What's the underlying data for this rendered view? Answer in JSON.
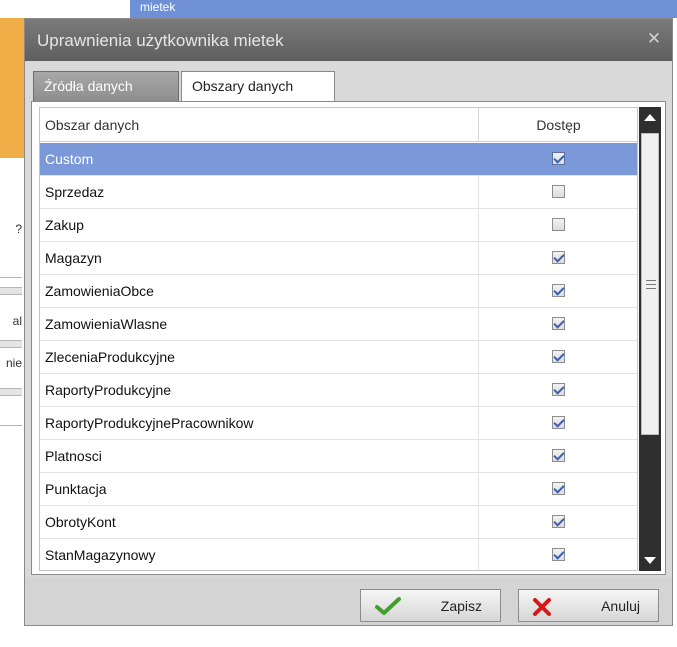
{
  "background": {
    "header_label": "mietek",
    "frag_question": "?",
    "frag_al": "al",
    "frag_nie": "nie"
  },
  "dialog": {
    "title": "Uprawnienia użytkownika mietek",
    "close_icon": "close-icon"
  },
  "tabs": [
    {
      "label": "Źródła danych",
      "active": false
    },
    {
      "label": "Obszary danych",
      "active": true
    }
  ],
  "grid": {
    "columns": [
      "Obszar danych",
      "Dostęp"
    ],
    "rows": [
      {
        "name": "Custom",
        "access": true,
        "selected": true
      },
      {
        "name": "Sprzedaz",
        "access": false,
        "selected": false
      },
      {
        "name": "Zakup",
        "access": false,
        "selected": false
      },
      {
        "name": "Magazyn",
        "access": true,
        "selected": false
      },
      {
        "name": "ZamowieniaObce",
        "access": true,
        "selected": false
      },
      {
        "name": "ZamowieniaWlasne",
        "access": true,
        "selected": false
      },
      {
        "name": "ZleceniaProdukcyjne",
        "access": true,
        "selected": false
      },
      {
        "name": "RaportyProdukcyjne",
        "access": true,
        "selected": false
      },
      {
        "name": "RaportyProdukcyjnePracownikow",
        "access": true,
        "selected": false
      },
      {
        "name": "Platnosci",
        "access": true,
        "selected": false
      },
      {
        "name": "Punktacja",
        "access": true,
        "selected": false
      },
      {
        "name": "ObrotyKont",
        "access": true,
        "selected": false
      },
      {
        "name": "StanMagazynowy",
        "access": true,
        "selected": false
      }
    ]
  },
  "buttons": {
    "save_label": "Zapisz",
    "cancel_label": "Anuluj"
  },
  "colors": {
    "selection": "#7b98d8",
    "titlebar": "#6b6b6b",
    "check_icon": "#43a02f",
    "cancel_icon": "#d81818",
    "scrollbar": "#2e2e2e"
  }
}
